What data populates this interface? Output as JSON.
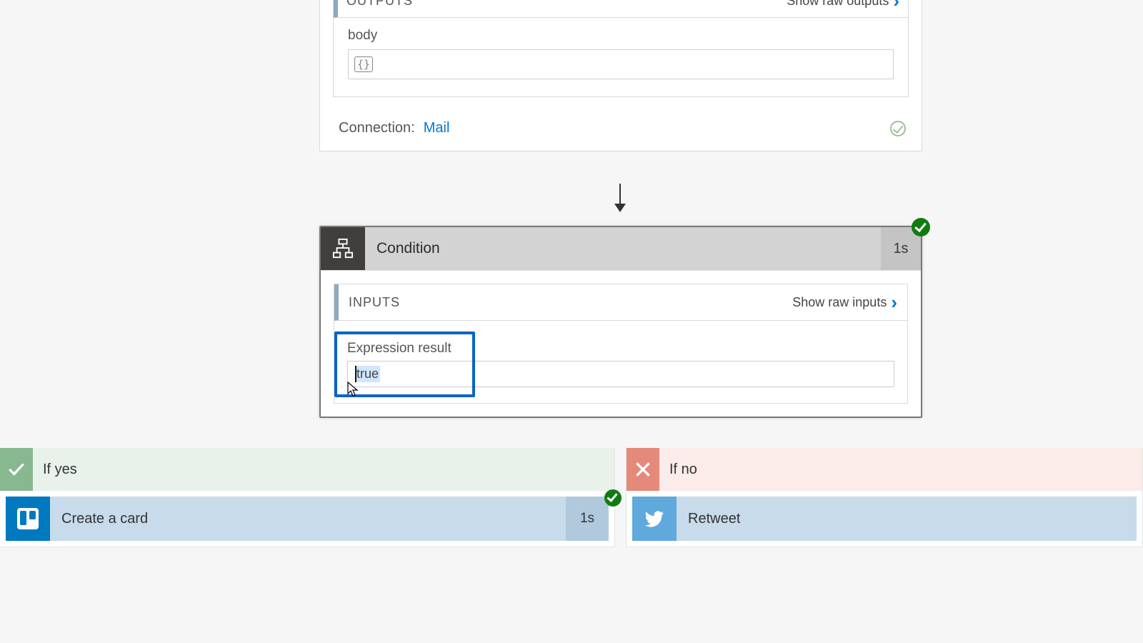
{
  "top_step": {
    "outputs_title": "OUTPUTS",
    "show_raw": "Show raw outputs",
    "body_label": "body",
    "json_token": "{}",
    "connection_label": "Connection:",
    "connection_name": "Mail"
  },
  "condition": {
    "title": "Condition",
    "duration": "1s",
    "inputs_title": "INPUTS",
    "show_raw": "Show raw inputs",
    "expr_label": "Expression result",
    "expr_value": "true"
  },
  "branches": {
    "yes": {
      "label": "If yes",
      "action_label": "Create a card",
      "action_duration": "1s"
    },
    "no": {
      "label": "If no",
      "action_label": "Retweet"
    }
  }
}
